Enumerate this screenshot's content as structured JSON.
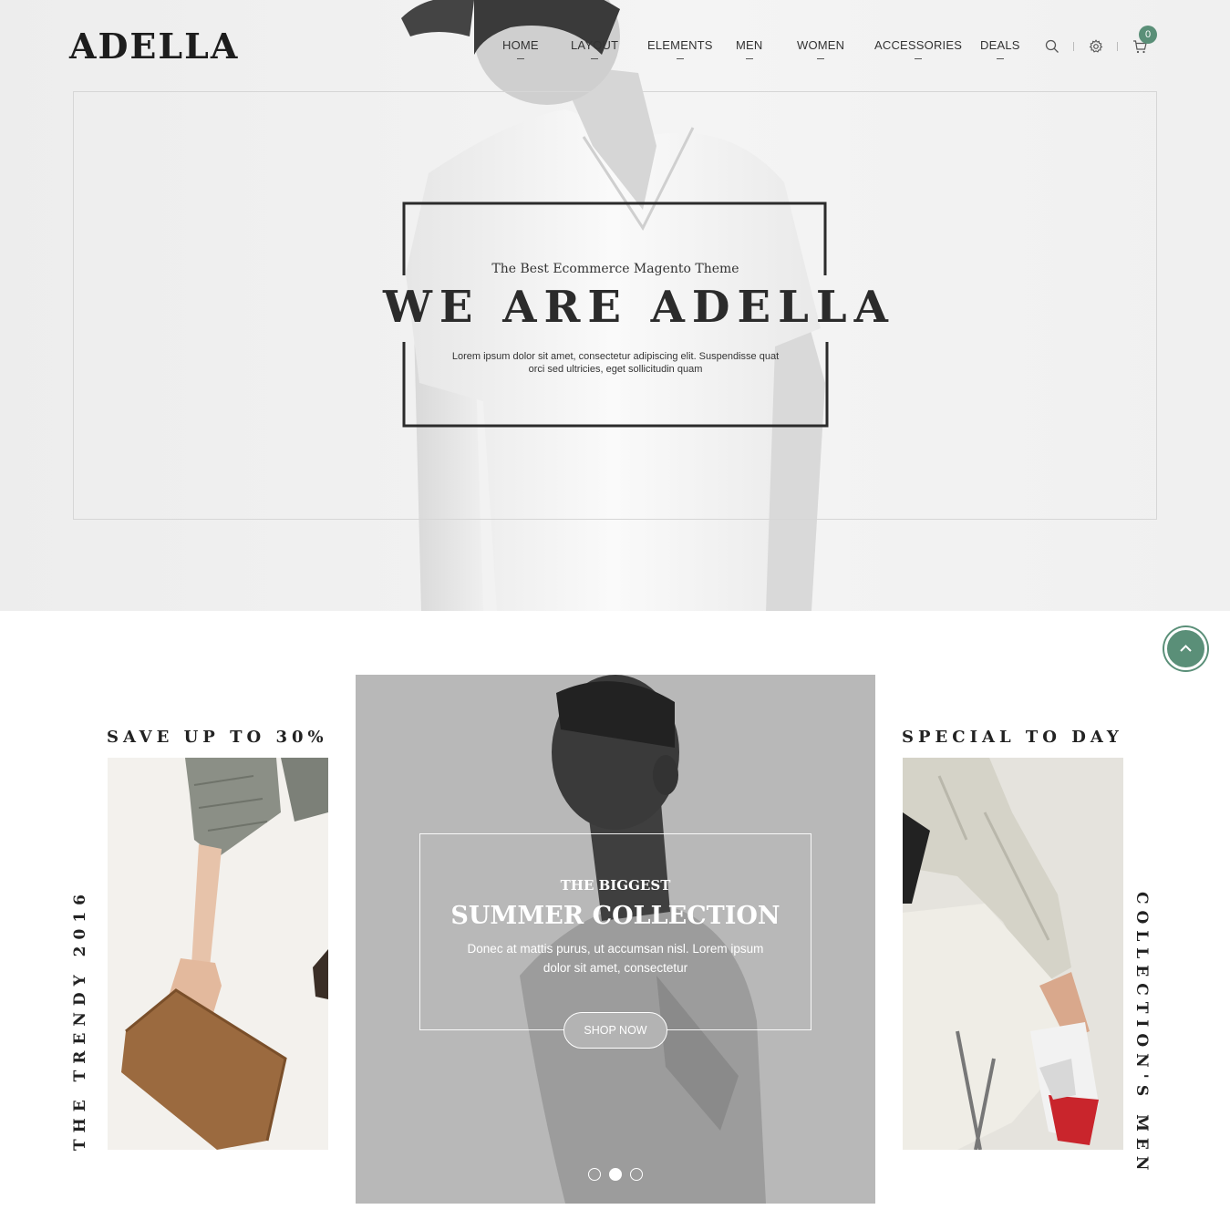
{
  "header": {
    "logo": "ADELLA",
    "nav": [
      "HOME",
      "LAYOUT",
      "ELEMENTS",
      "MEN",
      "WOMEN",
      "ACCESSORIES",
      "DEALS"
    ],
    "cart_count": "0",
    "icons": [
      "search-icon",
      "gear-icon",
      "cart-icon"
    ]
  },
  "hero": {
    "subtitle": "The Best Ecommerce Magento Theme",
    "title": "WE ARE ADELLA",
    "text": "Lorem ipsum dolor sit amet, consectetur adipiscing elit. Suspendisse quat orci sed ultricies, eget sollicitudin quam"
  },
  "promo_left": {
    "heading": "SAVE UP TO 30%",
    "vertical": "THE TRENDY 2016"
  },
  "slider": {
    "kicker": "THE BIGGEST",
    "title": "SUMMER COLLECTION",
    "text": "Donec at mattis purus, ut accumsan nisl. Lorem ipsum dolor sit amet, consectetur",
    "button": "SHOP NOW",
    "active_slide": 2,
    "slide_count": 3
  },
  "promo_right": {
    "heading": "SPECIAL TO DAY",
    "vertical": "COLLECTION'S MEN"
  },
  "colors": {
    "accent": "#5a8f78",
    "dark": "#2b2b2b"
  }
}
